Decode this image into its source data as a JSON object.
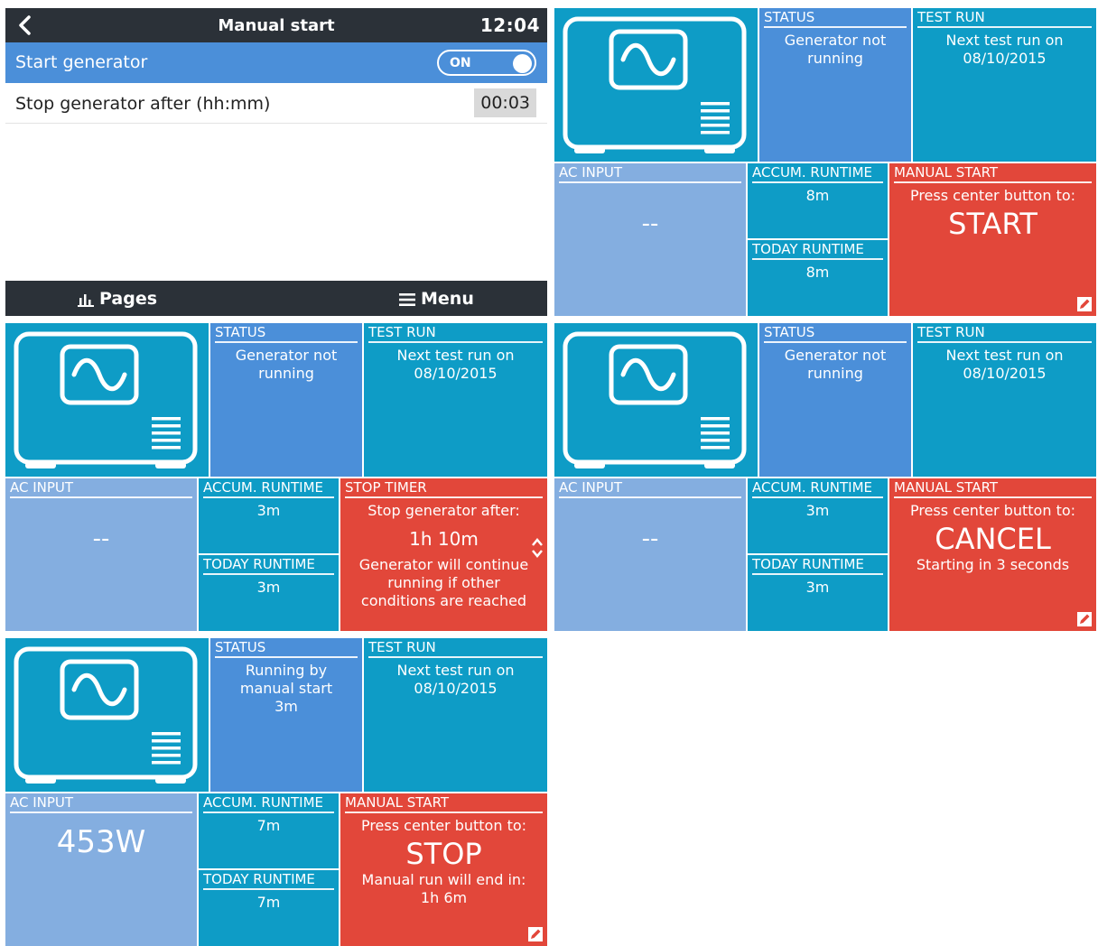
{
  "menu": {
    "title": "Manual start",
    "time": "12:04",
    "start_label": "Start generator",
    "toggle_value": "ON",
    "stop_label": "Stop generator after (hh:mm)",
    "stop_value": "00:03",
    "footer_pages": "Pages",
    "footer_menu": "Menu"
  },
  "labels": {
    "status": "STATUS",
    "test_run": "TEST RUN",
    "ac_input": "AC INPUT",
    "accum_runtime": "ACCUM. RUNTIME",
    "today_runtime": "TODAY RUNTIME",
    "manual_start": "MANUAL START",
    "stop_timer": "STOP TIMER"
  },
  "panels": [
    {
      "status_line1": "Generator not",
      "status_line2": "running",
      "status_line3": "",
      "test_line1": "Next test run on",
      "test_line2": "08/10/2015",
      "ac_input": "--",
      "accum": "8m",
      "today": "8m",
      "action_line1": "Press center button to:",
      "action_big": "START",
      "action_line3": "",
      "action_line4": ""
    },
    {
      "status_line1": "Generator not",
      "status_line2": "running",
      "status_line3": "",
      "test_line1": "Next test run on",
      "test_line2": "08/10/2015",
      "ac_input": "--",
      "accum": "3m",
      "today": "3m",
      "action_line1": "Stop generator after:",
      "action_big": "1h 10m",
      "action_line3": "Generator will continue",
      "action_line4": "running if other",
      "action_line5": "conditions are reached"
    },
    {
      "status_line1": "Generator not",
      "status_line2": "running",
      "status_line3": "",
      "test_line1": "Next test run on",
      "test_line2": "08/10/2015",
      "ac_input": "--",
      "accum": "3m",
      "today": "3m",
      "action_line1": "Press center button to:",
      "action_big": "CANCEL",
      "action_line3": "Starting in 3 seconds",
      "action_line4": ""
    },
    {
      "status_line1": "Running by",
      "status_line2": "manual start",
      "status_line3": "3m",
      "test_line1": "Next test run on",
      "test_line2": "08/10/2015",
      "ac_input": "453W",
      "accum": "7m",
      "today": "7m",
      "action_line1": "Press center button to:",
      "action_big": "STOP",
      "action_line3": "Manual run will end in:",
      "action_line4": "1h 6m"
    }
  ],
  "colors": {
    "header_dark": "#2b3138",
    "blue": "#4b8fd9",
    "teal": "#0e9cc6",
    "light_blue": "#84aee0",
    "red": "#e2473a"
  },
  "icons": [
    "back-arrow-icon",
    "pages-chart-icon",
    "menu-hamburger-icon",
    "generator-icon",
    "edit-pencil-icon",
    "up-down-arrows-icon"
  ]
}
